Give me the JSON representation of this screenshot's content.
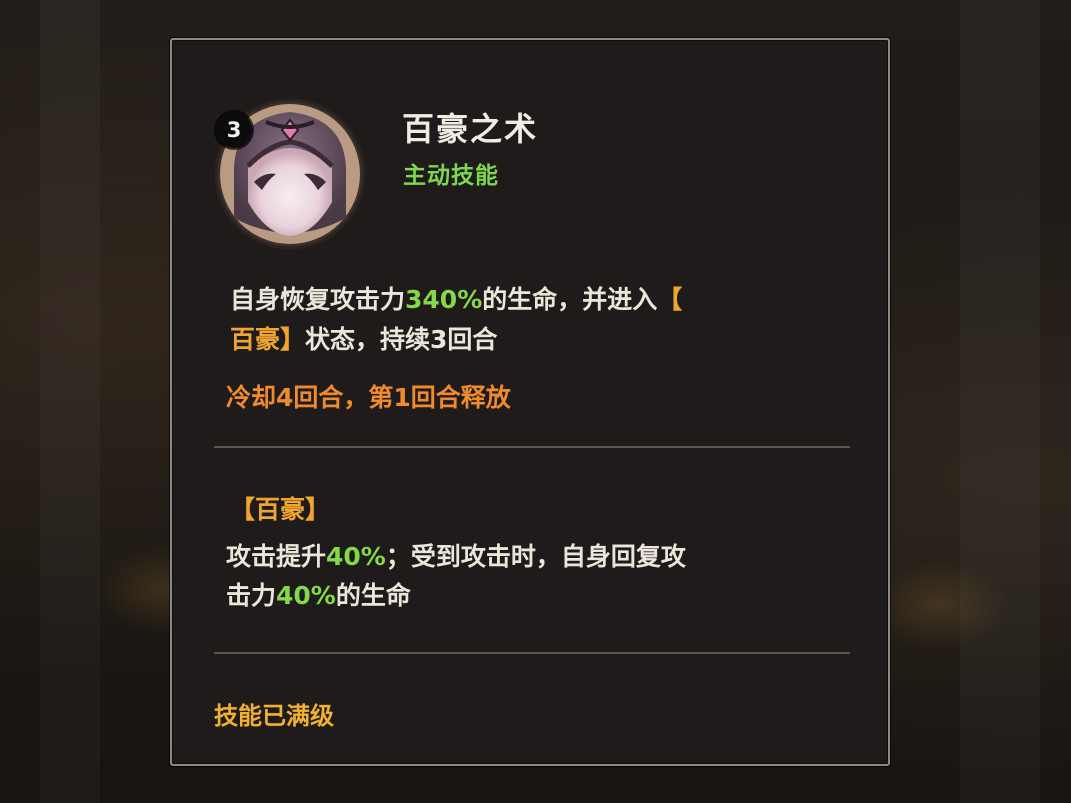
{
  "skill": {
    "level": "3",
    "name": "百豪之术",
    "type": "主动技能",
    "description": {
      "part1": "自身恢复攻击力",
      "value": "340%",
      "part2": "的生命，并进入",
      "bracket_open": "【",
      "status_name": "百豪",
      "bracket_close": "】",
      "part3": "状态，持续3回合"
    },
    "cooldown": "冷却4回合，第1回合释放"
  },
  "status_effect": {
    "title": "【百豪】",
    "line1_prefix": "攻击提升",
    "line1_value": "40%",
    "line1_suffix": "；受到攻击时，自身回复攻",
    "line2_prefix": "击力",
    "line2_value": "40%",
    "line2_suffix": "的生命"
  },
  "footer": {
    "max_level_text": "技能已满级"
  },
  "colors": {
    "green": "#84d84a",
    "orange": "#f0a530",
    "cooldown_orange": "#f08a2e",
    "text": "#ece6da",
    "panel_bg": "#1e1b1a",
    "border": "#8d8984"
  },
  "icons": {
    "portrait": "character-portrait-icon"
  }
}
